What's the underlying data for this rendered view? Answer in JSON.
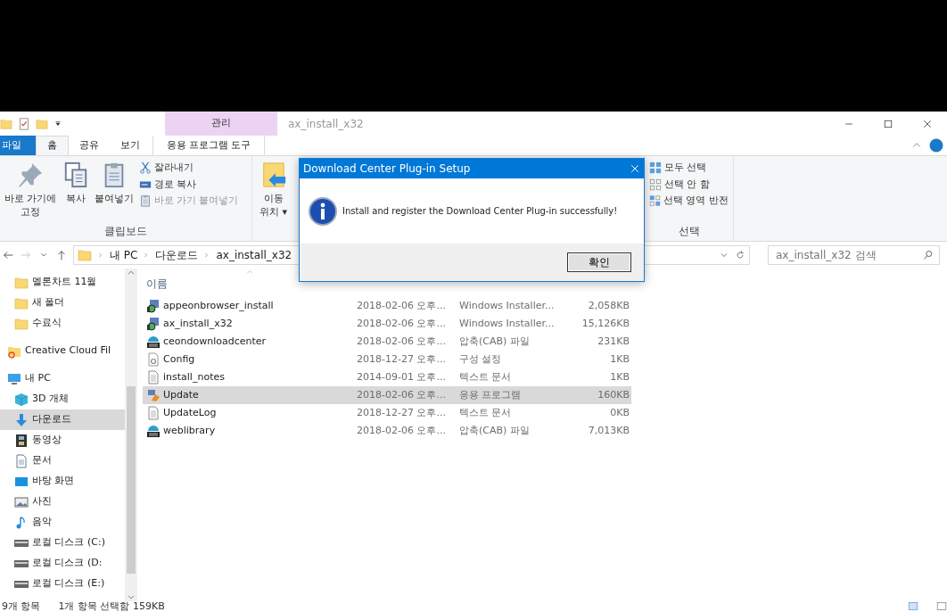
{
  "window": {
    "title": "ax_install_x32",
    "context_tab": "관리"
  },
  "ribbon_tabs": [
    {
      "label": "파일",
      "kind": "file",
      "selected": false
    },
    {
      "label": "홈",
      "kind": "tab",
      "selected": true
    },
    {
      "label": "공유",
      "kind": "tab",
      "selected": false
    },
    {
      "label": "보기",
      "kind": "tab",
      "selected": false
    },
    {
      "label": "응용 프로그램 도구",
      "kind": "context",
      "selected": false
    }
  ],
  "clipboard_group": {
    "label": "클립보드",
    "large_buttons": [
      {
        "label": "바로 가기에",
        "label_2": "고정"
      },
      {
        "label": "복사"
      },
      {
        "label": "붙여넣기"
      }
    ],
    "small_buttons": [
      {
        "label": "잘라내기",
        "disabled": false
      },
      {
        "label": "경로 복사",
        "disabled": false
      },
      {
        "label": "바로 가기 붙여넣기",
        "disabled": true
      }
    ]
  },
  "organize_group": {
    "move_button": {
      "label": "이동",
      "label_2": "위치",
      "caret": "▾"
    }
  },
  "select_group": {
    "label": "선택",
    "items": [
      {
        "label": "모두 선택"
      },
      {
        "label": "선택 안 함"
      },
      {
        "label": "선택 영역 반전"
      }
    ]
  },
  "address_bar": {
    "crumbs": [
      "내 PC",
      "다운로드",
      "ax_install_x32"
    ]
  },
  "search": {
    "placeholder": "ax_install_x32 검색"
  },
  "nav_pane": [
    {
      "label": "멜론차트 11월",
      "kind": "folder",
      "selected": false
    },
    {
      "label": "새 폴더",
      "kind": "folder",
      "selected": false
    },
    {
      "label": "수료식",
      "kind": "folder",
      "selected": false
    },
    {
      "label": "Creative Cloud Fil",
      "kind": "cloud",
      "selected": false
    },
    {
      "label": "내 PC",
      "kind": "pc",
      "selected": false
    },
    {
      "label": "3D 개체",
      "kind": "cube",
      "selected": false
    },
    {
      "label": "다운로드",
      "kind": "download",
      "selected": true
    },
    {
      "label": "동영상",
      "kind": "video",
      "selected": false
    },
    {
      "label": "문서",
      "kind": "doc",
      "selected": false
    },
    {
      "label": "바탕 화면",
      "kind": "desktop",
      "selected": false
    },
    {
      "label": "사진",
      "kind": "photo",
      "selected": false
    },
    {
      "label": "음악",
      "kind": "music",
      "selected": false
    },
    {
      "label": "로컬 디스크 (C:)",
      "kind": "drive",
      "selected": false
    },
    {
      "label": "로컬 디스크 (D:",
      "kind": "drive",
      "selected": false
    },
    {
      "label": "로컬 디스크 (E:)",
      "kind": "drive",
      "selected": false
    }
  ],
  "file_list": {
    "name_column": "이름",
    "rows": [
      {
        "name": "appeonbrowser_install",
        "date": "2018-02-06 오후...",
        "type": "Windows Installer...",
        "size": "2,058KB",
        "kind": "installer",
        "selected": false
      },
      {
        "name": "ax_install_x32",
        "date": "2018-02-06 오후...",
        "type": "Windows Installer...",
        "size": "15,126KB",
        "kind": "installer",
        "selected": false
      },
      {
        "name": "ceondownloadcenter",
        "date": "2018-02-06 오후...",
        "type": "압축(CAB) 파일",
        "size": "231KB",
        "kind": "cab",
        "selected": false
      },
      {
        "name": "Config",
        "date": "2018-12-27 오후...",
        "type": "구성 설정",
        "size": "1KB",
        "kind": "config",
        "selected": false
      },
      {
        "name": "install_notes",
        "date": "2014-09-01 오후...",
        "type": "텍스트 문서",
        "size": "1KB",
        "kind": "text",
        "selected": false
      },
      {
        "name": "Update",
        "date": "2018-02-06 오후...",
        "type": "응용 프로그램",
        "size": "160KB",
        "kind": "app",
        "selected": true
      },
      {
        "name": "UpdateLog",
        "date": "2018-12-27 오후...",
        "type": "텍스트 문서",
        "size": "0KB",
        "kind": "text",
        "selected": false
      },
      {
        "name": "weblibrary",
        "date": "2018-02-06 오후...",
        "type": "압축(CAB) 파일",
        "size": "7,013KB",
        "kind": "cab",
        "selected": false
      }
    ]
  },
  "status_bar": {
    "item_count": "9개 항목",
    "selection": "1개 항목 선택함 159KB"
  },
  "dialog": {
    "title": "Download Center Plug-in Setup",
    "message": "Install and register the Download Center Plug-in successfully!",
    "button": "확인"
  }
}
